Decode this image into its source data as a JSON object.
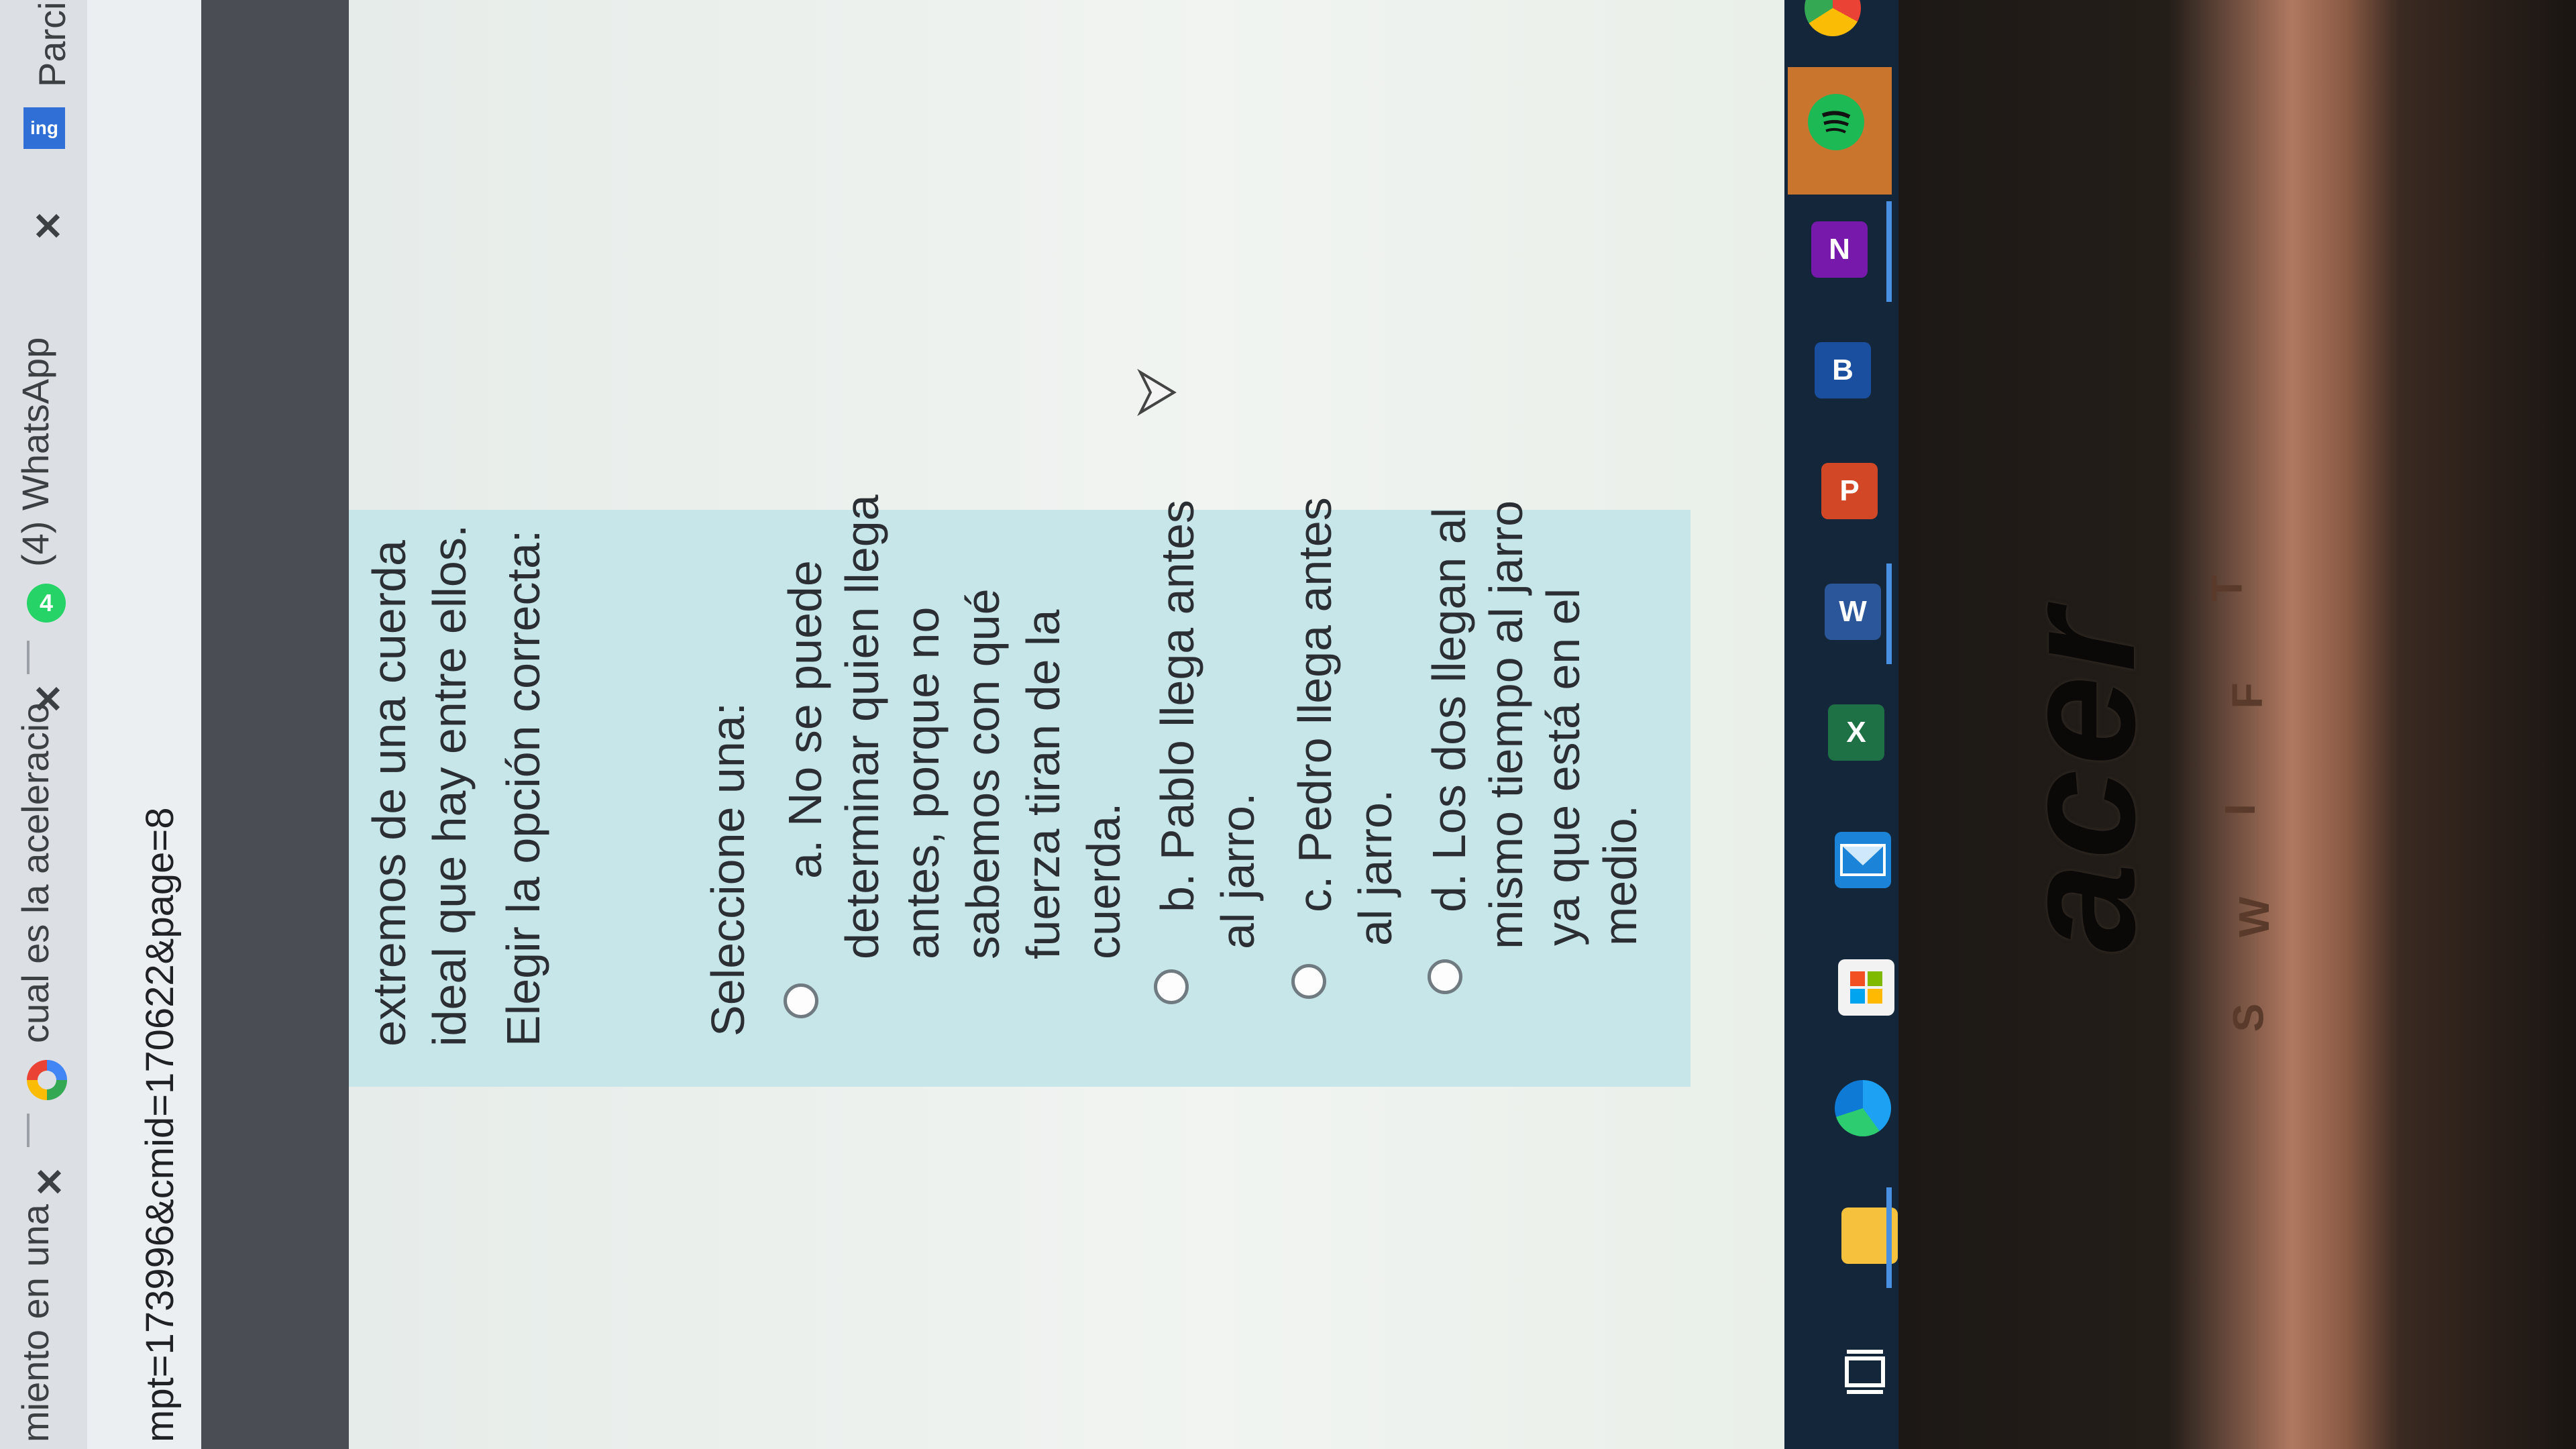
{
  "browser": {
    "tabs": [
      {
        "label": "miento en una",
        "close": "✕"
      },
      {
        "label": "cual es la aceleracio",
        "close": "✕"
      },
      {
        "label": "(4) WhatsApp",
        "close": "✕",
        "badge": "4"
      }
    ],
    "bookmark": {
      "icon_text": "ing",
      "label": "Parcial"
    },
    "address": "mpt=173996&cmid=170622&page=8"
  },
  "question": {
    "text_lines": [
      "extremos de una cuerda",
      "ideal que hay entre ellos.",
      "Elegir la opción correcta:"
    ],
    "select_prompt": "Seleccione una:",
    "options": [
      {
        "lines": [
          "a. No se puede",
          "determinar quien llega",
          "antes, porque no",
          "sabemos con qué",
          "fuerza tiran de la",
          "cuerda."
        ]
      },
      {
        "lines": [
          "b. Pablo llega antes",
          "al jarro."
        ]
      },
      {
        "lines": [
          "c. Pedro llega antes",
          "al jarro."
        ]
      },
      {
        "lines": [
          "d. Los dos llegan al",
          "mismo tiempo al jarro",
          "ya que está en el",
          "medio."
        ]
      }
    ]
  },
  "taskbar": {
    "icons": [
      "task-view-icon",
      "file-explorer-icon",
      "edge-icon",
      "store-icon",
      "mail-icon",
      "excel-icon",
      "word-icon",
      "powerpoint-icon",
      "bitdefender-icon",
      "onenote-icon",
      "spotify-icon",
      "chrome-icon"
    ],
    "labels": {
      "excel": "X",
      "word": "W",
      "powerpoint": "P",
      "bitdefender": "B",
      "onenote": "N"
    }
  },
  "device": {
    "brand": "acer",
    "keys": [
      "S",
      "W",
      "I",
      "F",
      "T"
    ]
  }
}
